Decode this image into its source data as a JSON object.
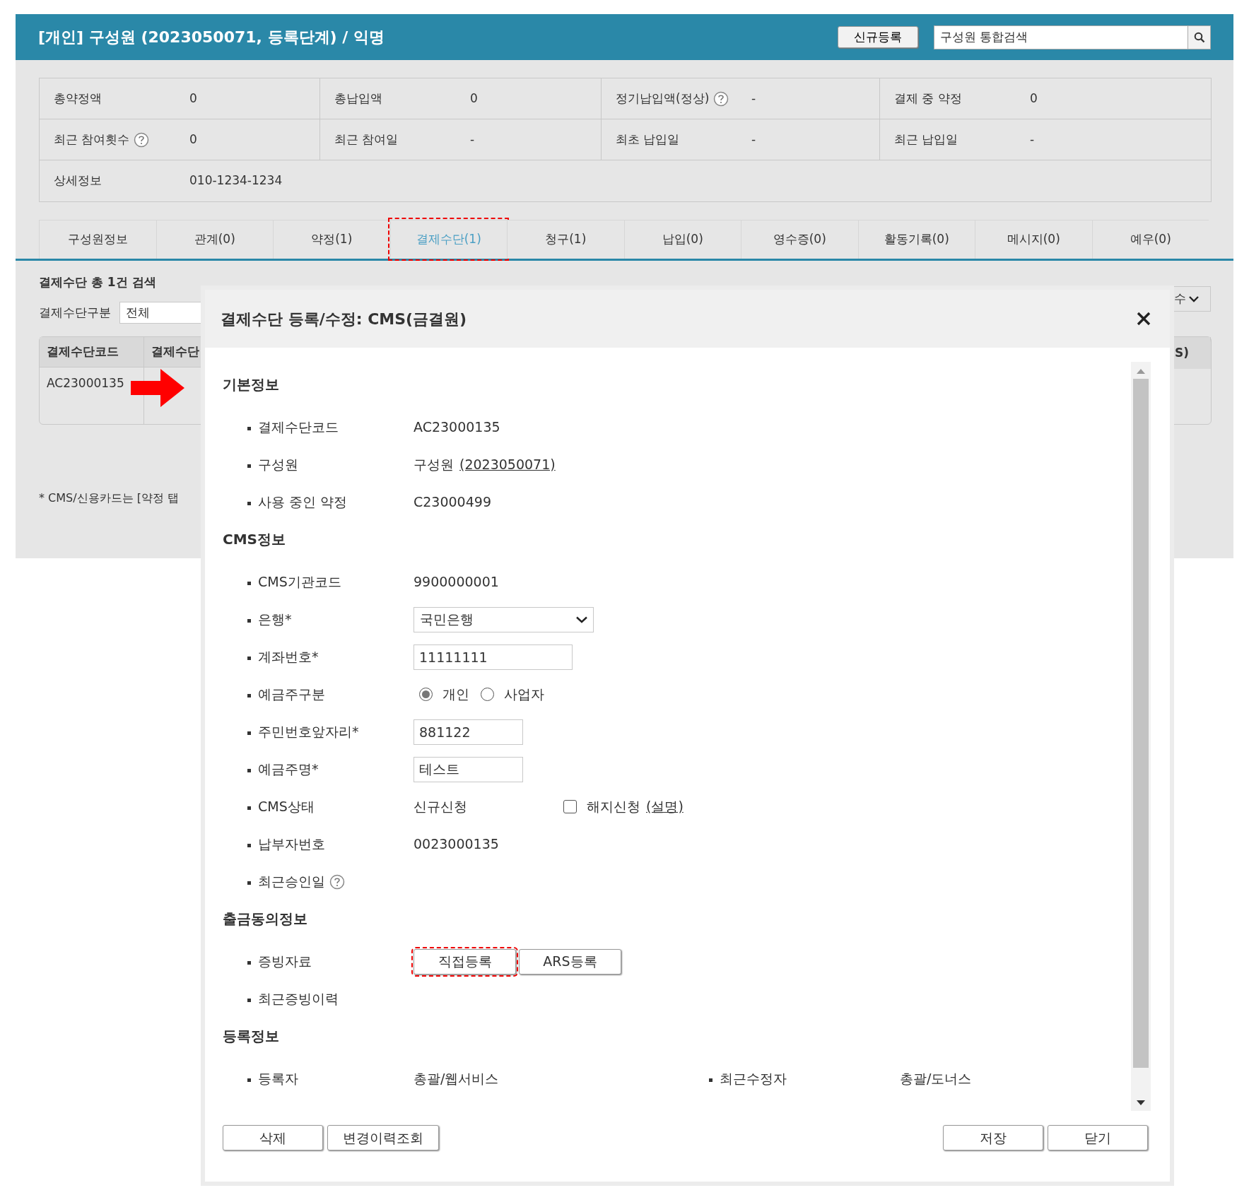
{
  "header": {
    "title": "[개인] 구성원 (2023050071, 등록단계) / 익명",
    "new_button": "신규등록",
    "search": {
      "value": "구성원 통합검색"
    }
  },
  "summary": [
    [
      {
        "label": "총약정액",
        "value": "0",
        "help": false
      },
      {
        "label": "총납입액",
        "value": "0",
        "help": false
      },
      {
        "label": "정기납입액(정상)",
        "value": "-",
        "help": true
      },
      {
        "label": "결제 중 약정",
        "value": "0",
        "help": false
      }
    ],
    [
      {
        "label": "최근 참여횟수",
        "value": "0",
        "help": true
      },
      {
        "label": "최근 참여일",
        "value": "-",
        "help": false
      },
      {
        "label": "최초 납입일",
        "value": "-",
        "help": false
      },
      {
        "label": "최근 납입일",
        "value": "-",
        "help": false
      }
    ],
    [
      {
        "label": "상세정보",
        "value": "010-1234-1234",
        "help": false
      }
    ]
  ],
  "tabs": [
    {
      "label": "구성원정보",
      "selected": false,
      "highlighted": false
    },
    {
      "label": "관계(0)",
      "selected": false,
      "highlighted": false
    },
    {
      "label": "약정(1)",
      "selected": false,
      "highlighted": false
    },
    {
      "label": "결제수단(1)",
      "selected": true,
      "highlighted": true
    },
    {
      "label": "청구(1)",
      "selected": false,
      "highlighted": false
    },
    {
      "label": "납입(0)",
      "selected": false,
      "highlighted": false
    },
    {
      "label": "영수증(0)",
      "selected": false,
      "highlighted": false
    },
    {
      "label": "활동기록(0)",
      "selected": false,
      "highlighted": false
    },
    {
      "label": "메시지(0)",
      "selected": false,
      "highlighted": false
    },
    {
      "label": "예우(0)",
      "selected": false,
      "highlighted": false
    }
  ],
  "list": {
    "count_text": "결제수단 총 1건 검색",
    "filter_label": "결제수단구분",
    "filter_value": "전체",
    "page_size_text": "수",
    "columns": [
      "결제수단코드",
      "결제수단"
    ],
    "cut_column": "S)",
    "rows": [
      [
        "AC23000135"
      ]
    ],
    "note": "* CMS/신용카드는 [약정 탭"
  },
  "dialog": {
    "title": "결제수단 등록/수정: CMS(금결원)",
    "sections": [
      {
        "title": "기본정보",
        "fields": [
          {
            "kind": "text",
            "label": "결제수단코드",
            "value": "AC23000135"
          },
          {
            "kind": "link",
            "label": "구성원",
            "value": "구성원",
            "link": "(2023050071)"
          },
          {
            "kind": "text",
            "label": "사용 중인 약정",
            "value": "C23000499"
          }
        ]
      },
      {
        "title": "CMS정보",
        "fields": [
          {
            "kind": "text",
            "label": "CMS기관코드",
            "value": "9900000001"
          },
          {
            "kind": "select",
            "label": "은행*",
            "value": "국민은행"
          },
          {
            "kind": "input",
            "label": "계좌번호*",
            "value": "11111111"
          },
          {
            "kind": "radio",
            "label": "예금주구분",
            "options": [
              {
                "label": "개인",
                "selected": true
              },
              {
                "label": "사업자",
                "selected": false
              }
            ]
          },
          {
            "kind": "input",
            "label": "주민번호앞자리*",
            "value": "881122"
          },
          {
            "kind": "input",
            "label": "예금주명*",
            "value": "테스트"
          },
          {
            "kind": "status",
            "label": "CMS상태",
            "value": "신규신청",
            "checkbox": {
              "label": "해지신청",
              "checked": false
            },
            "link": "(설명)"
          },
          {
            "kind": "text",
            "label": "납부자번호",
            "value": "0023000135"
          },
          {
            "kind": "help",
            "label": "최근승인일"
          }
        ]
      },
      {
        "title": "출금동의정보",
        "fields": [
          {
            "kind": "buttons",
            "label": "증빙자료",
            "buttons": [
              {
                "label": "직접등록",
                "highlighted": true
              },
              {
                "label": "ARS등록",
                "highlighted": false
              }
            ]
          },
          {
            "kind": "empty",
            "label": "최근증빙이력"
          }
        ]
      },
      {
        "title": "등록정보",
        "fields": [
          {
            "kind": "pair",
            "label": "등록자",
            "value": "총괄/웹서비스",
            "label2": "최근수정자",
            "value2": "총괄/도너스"
          }
        ]
      }
    ],
    "footer_left": [
      "삭제",
      "변경이력조회"
    ],
    "footer_right": [
      "저장",
      "닫기"
    ]
  }
}
